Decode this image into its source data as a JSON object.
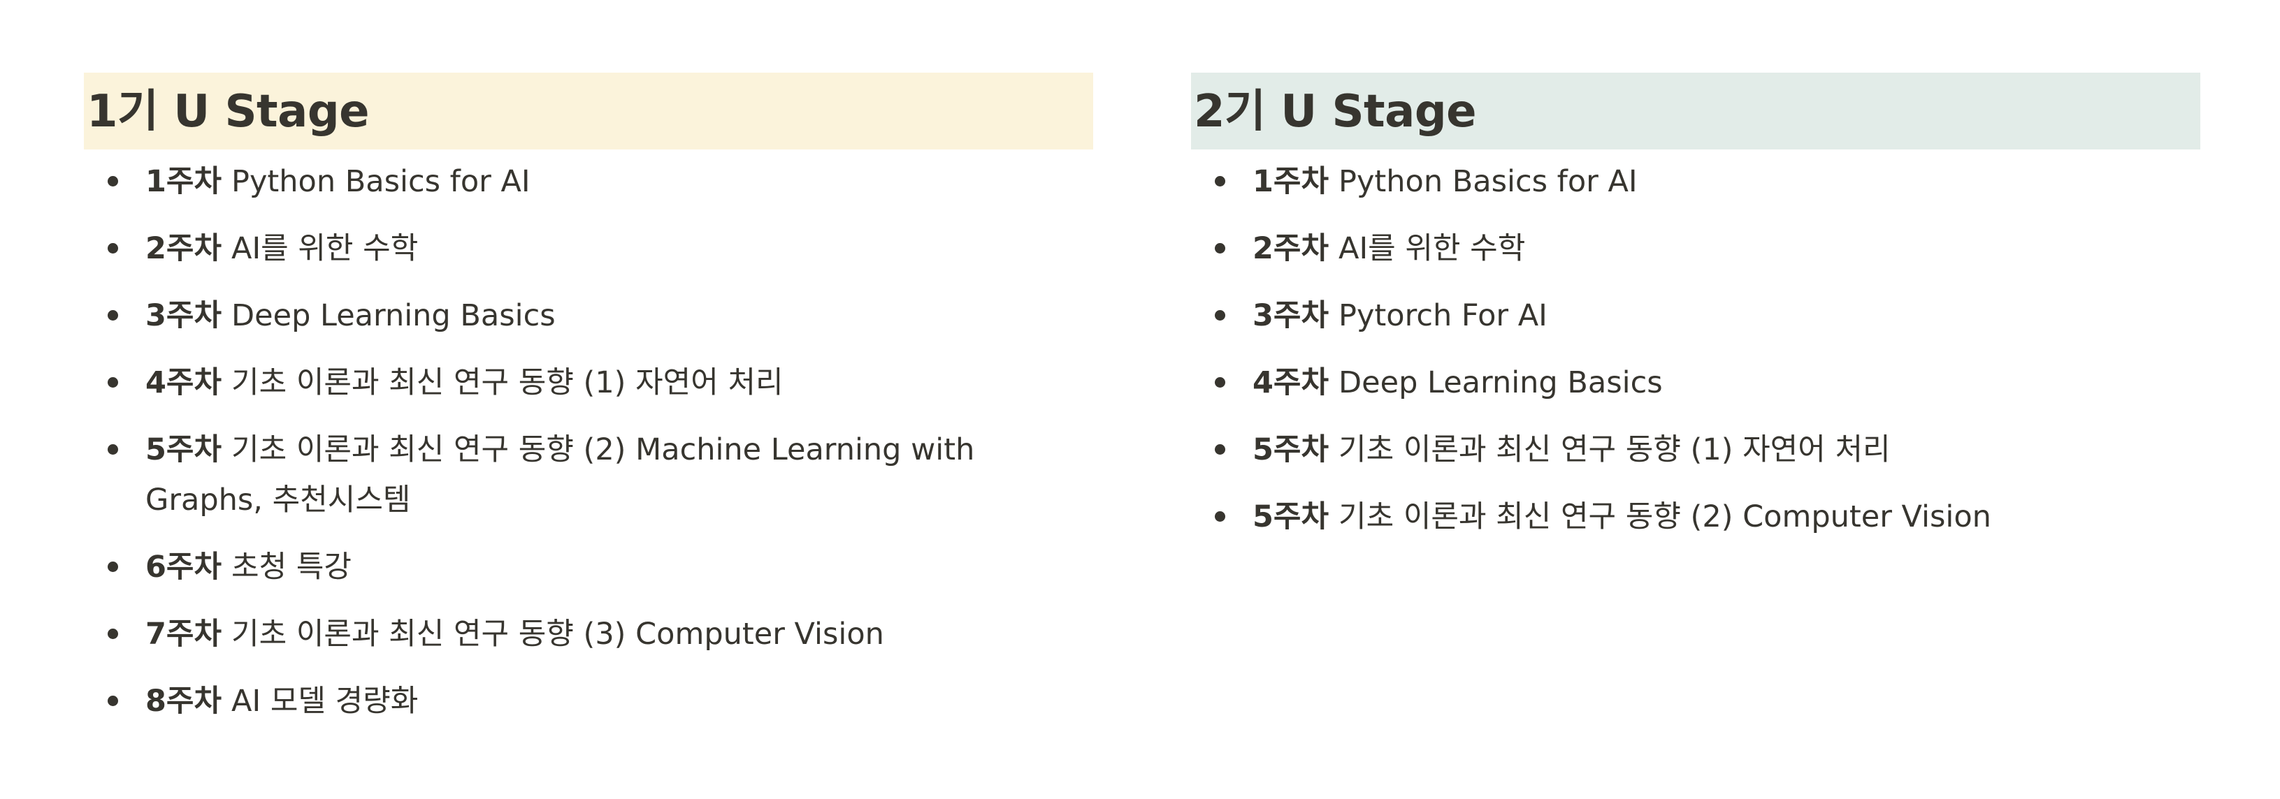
{
  "stages": [
    {
      "title": "1기 U Stage",
      "weeks": [
        {
          "week": "1주차",
          "title": "Python Basics for AI"
        },
        {
          "week": "2주차",
          "title": "AI를 위한 수학"
        },
        {
          "week": "3주차",
          "title": "Deep Learning Basics"
        },
        {
          "week": "4주차",
          "title": "기초 이론과 최신 연구 동향 (1) 자연어 처리"
        },
        {
          "week": "5주차",
          "title": "기초 이론과 최신 연구 동향 (2) Machine Learning with Graphs, 추천시스템"
        },
        {
          "week": "6주차",
          "title": "초청 특강"
        },
        {
          "week": "7주차",
          "title": "기초 이론과 최신 연구 동향 (3) Computer Vision"
        },
        {
          "week": "8주차",
          "title": "AI 모델 경량화"
        }
      ]
    },
    {
      "title": "2기 U Stage",
      "weeks": [
        {
          "week": "1주차",
          "title": "Python Basics for AI"
        },
        {
          "week": "2주차",
          "title": "AI를 위한 수학"
        },
        {
          "week": "3주차",
          "title": "Pytorch For AI"
        },
        {
          "week": "4주차",
          "title": "Deep Learning Basics"
        },
        {
          "week": "5주차",
          "title": "기초 이론과 최신 연구 동향 (1) 자연어 처리"
        },
        {
          "week": "5주차",
          "title": "기초 이론과 최신 연구 동향 (2) Computer Vision"
        }
      ]
    }
  ],
  "colors": {
    "text": "#37352f",
    "stage_1_highlight": "#fbf3db",
    "stage_2_highlight": "#e2ece8"
  }
}
